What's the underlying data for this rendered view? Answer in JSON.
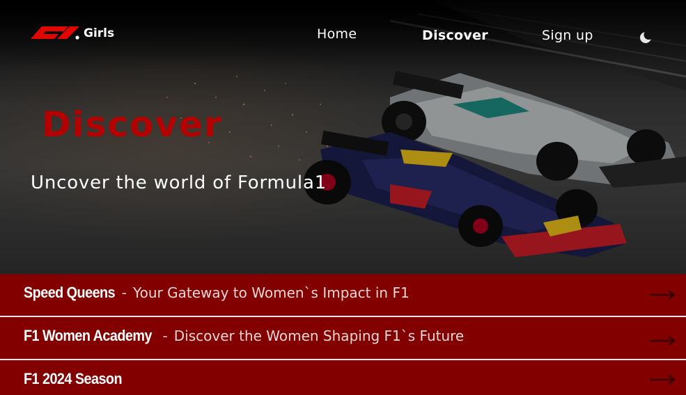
{
  "app": {
    "logo_mark": "F1",
    "logo_suffix": "Girls"
  },
  "nav": {
    "items": [
      {
        "label": "Home",
        "active": false
      },
      {
        "label": "Discover",
        "active": true
      },
      {
        "label": "Sign up",
        "active": false
      }
    ],
    "theme_icon": "moon-icon"
  },
  "hero": {
    "title": "Discover",
    "subtitle": "Uncover the world of Formula1",
    "title_color": "#b30000"
  },
  "sections": [
    {
      "title": "Speed Queens",
      "separator": "-",
      "description": "Your Gateway to Women`s Impact in F1",
      "icon": "arrow-right-icon"
    },
    {
      "title": "F1 Women Academy",
      "separator": "-",
      "description": "Discover the Women Shaping F1`s Future",
      "icon": "arrow-right-icon"
    },
    {
      "title": "F1 2024 Season",
      "separator": "",
      "description": "",
      "icon": "arrow-right-icon"
    }
  ],
  "colors": {
    "accent": "#830000",
    "brand_red": "#e10600"
  }
}
